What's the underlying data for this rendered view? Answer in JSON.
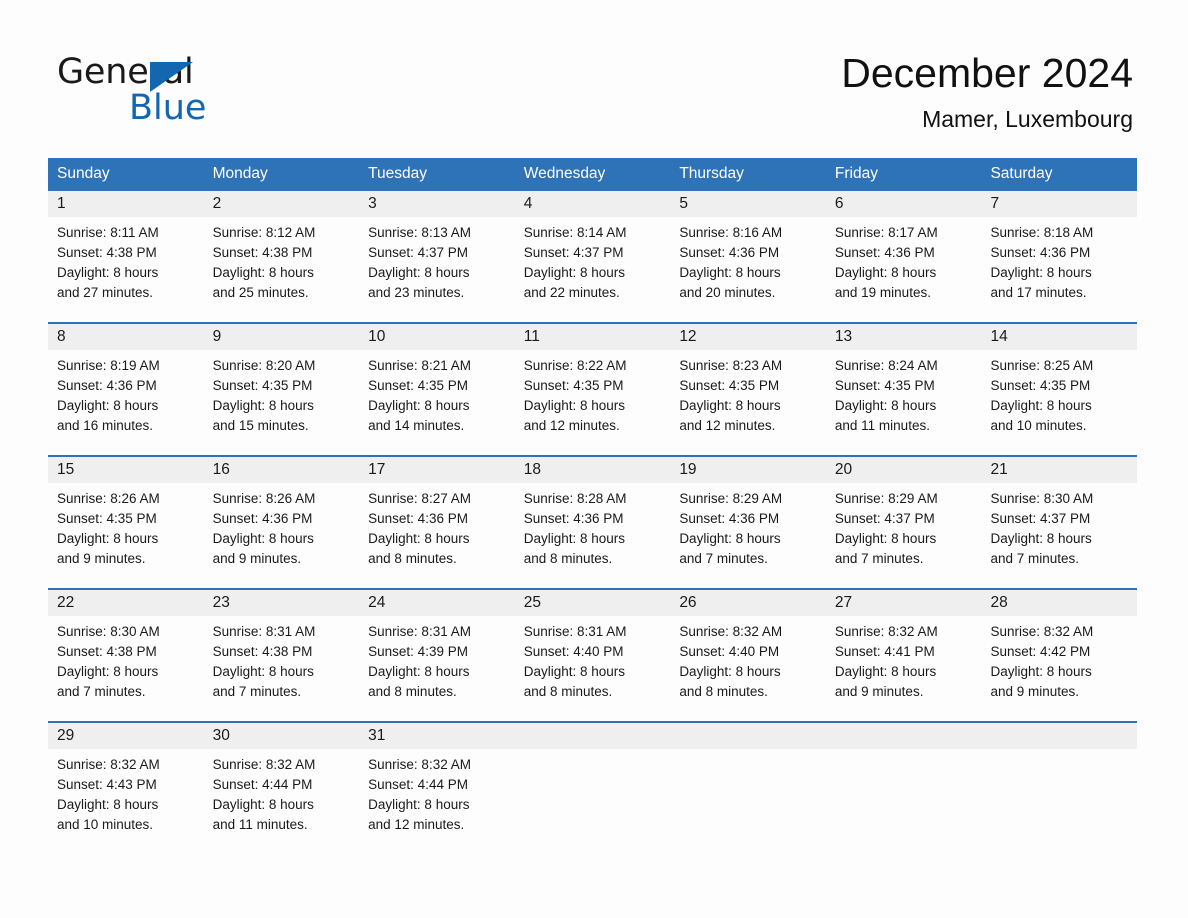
{
  "brand": {
    "name_part1": "General",
    "name_part2": "Blue",
    "triangle_icon": "triangle-icon",
    "accent_color": "#1267b0"
  },
  "header": {
    "month_title": "December 2024",
    "location": "Mamer, Luxembourg"
  },
  "colors": {
    "header_blue": "#2e72b8",
    "day_band_gray": "#efefef",
    "text": "#1a1a1a"
  },
  "weekdays": [
    "Sunday",
    "Monday",
    "Tuesday",
    "Wednesday",
    "Thursday",
    "Friday",
    "Saturday"
  ],
  "weeks": [
    [
      {
        "day": "1",
        "sunrise": "Sunrise: 8:11 AM",
        "sunset": "Sunset: 4:38 PM",
        "daylight_l1": "Daylight: 8 hours",
        "daylight_l2": "and 27 minutes."
      },
      {
        "day": "2",
        "sunrise": "Sunrise: 8:12 AM",
        "sunset": "Sunset: 4:38 PM",
        "daylight_l1": "Daylight: 8 hours",
        "daylight_l2": "and 25 minutes."
      },
      {
        "day": "3",
        "sunrise": "Sunrise: 8:13 AM",
        "sunset": "Sunset: 4:37 PM",
        "daylight_l1": "Daylight: 8 hours",
        "daylight_l2": "and 23 minutes."
      },
      {
        "day": "4",
        "sunrise": "Sunrise: 8:14 AM",
        "sunset": "Sunset: 4:37 PM",
        "daylight_l1": "Daylight: 8 hours",
        "daylight_l2": "and 22 minutes."
      },
      {
        "day": "5",
        "sunrise": "Sunrise: 8:16 AM",
        "sunset": "Sunset: 4:36 PM",
        "daylight_l1": "Daylight: 8 hours",
        "daylight_l2": "and 20 minutes."
      },
      {
        "day": "6",
        "sunrise": "Sunrise: 8:17 AM",
        "sunset": "Sunset: 4:36 PM",
        "daylight_l1": "Daylight: 8 hours",
        "daylight_l2": "and 19 minutes."
      },
      {
        "day": "7",
        "sunrise": "Sunrise: 8:18 AM",
        "sunset": "Sunset: 4:36 PM",
        "daylight_l1": "Daylight: 8 hours",
        "daylight_l2": "and 17 minutes."
      }
    ],
    [
      {
        "day": "8",
        "sunrise": "Sunrise: 8:19 AM",
        "sunset": "Sunset: 4:36 PM",
        "daylight_l1": "Daylight: 8 hours",
        "daylight_l2": "and 16 minutes."
      },
      {
        "day": "9",
        "sunrise": "Sunrise: 8:20 AM",
        "sunset": "Sunset: 4:35 PM",
        "daylight_l1": "Daylight: 8 hours",
        "daylight_l2": "and 15 minutes."
      },
      {
        "day": "10",
        "sunrise": "Sunrise: 8:21 AM",
        "sunset": "Sunset: 4:35 PM",
        "daylight_l1": "Daylight: 8 hours",
        "daylight_l2": "and 14 minutes."
      },
      {
        "day": "11",
        "sunrise": "Sunrise: 8:22 AM",
        "sunset": "Sunset: 4:35 PM",
        "daylight_l1": "Daylight: 8 hours",
        "daylight_l2": "and 12 minutes."
      },
      {
        "day": "12",
        "sunrise": "Sunrise: 8:23 AM",
        "sunset": "Sunset: 4:35 PM",
        "daylight_l1": "Daylight: 8 hours",
        "daylight_l2": "and 12 minutes."
      },
      {
        "day": "13",
        "sunrise": "Sunrise: 8:24 AM",
        "sunset": "Sunset: 4:35 PM",
        "daylight_l1": "Daylight: 8 hours",
        "daylight_l2": "and 11 minutes."
      },
      {
        "day": "14",
        "sunrise": "Sunrise: 8:25 AM",
        "sunset": "Sunset: 4:35 PM",
        "daylight_l1": "Daylight: 8 hours",
        "daylight_l2": "and 10 minutes."
      }
    ],
    [
      {
        "day": "15",
        "sunrise": "Sunrise: 8:26 AM",
        "sunset": "Sunset: 4:35 PM",
        "daylight_l1": "Daylight: 8 hours",
        "daylight_l2": "and 9 minutes."
      },
      {
        "day": "16",
        "sunrise": "Sunrise: 8:26 AM",
        "sunset": "Sunset: 4:36 PM",
        "daylight_l1": "Daylight: 8 hours",
        "daylight_l2": "and 9 minutes."
      },
      {
        "day": "17",
        "sunrise": "Sunrise: 8:27 AM",
        "sunset": "Sunset: 4:36 PM",
        "daylight_l1": "Daylight: 8 hours",
        "daylight_l2": "and 8 minutes."
      },
      {
        "day": "18",
        "sunrise": "Sunrise: 8:28 AM",
        "sunset": "Sunset: 4:36 PM",
        "daylight_l1": "Daylight: 8 hours",
        "daylight_l2": "and 8 minutes."
      },
      {
        "day": "19",
        "sunrise": "Sunrise: 8:29 AM",
        "sunset": "Sunset: 4:36 PM",
        "daylight_l1": "Daylight: 8 hours",
        "daylight_l2": "and 7 minutes."
      },
      {
        "day": "20",
        "sunrise": "Sunrise: 8:29 AM",
        "sunset": "Sunset: 4:37 PM",
        "daylight_l1": "Daylight: 8 hours",
        "daylight_l2": "and 7 minutes."
      },
      {
        "day": "21",
        "sunrise": "Sunrise: 8:30 AM",
        "sunset": "Sunset: 4:37 PM",
        "daylight_l1": "Daylight: 8 hours",
        "daylight_l2": "and 7 minutes."
      }
    ],
    [
      {
        "day": "22",
        "sunrise": "Sunrise: 8:30 AM",
        "sunset": "Sunset: 4:38 PM",
        "daylight_l1": "Daylight: 8 hours",
        "daylight_l2": "and 7 minutes."
      },
      {
        "day": "23",
        "sunrise": "Sunrise: 8:31 AM",
        "sunset": "Sunset: 4:38 PM",
        "daylight_l1": "Daylight: 8 hours",
        "daylight_l2": "and 7 minutes."
      },
      {
        "day": "24",
        "sunrise": "Sunrise: 8:31 AM",
        "sunset": "Sunset: 4:39 PM",
        "daylight_l1": "Daylight: 8 hours",
        "daylight_l2": "and 8 minutes."
      },
      {
        "day": "25",
        "sunrise": "Sunrise: 8:31 AM",
        "sunset": "Sunset: 4:40 PM",
        "daylight_l1": "Daylight: 8 hours",
        "daylight_l2": "and 8 minutes."
      },
      {
        "day": "26",
        "sunrise": "Sunrise: 8:32 AM",
        "sunset": "Sunset: 4:40 PM",
        "daylight_l1": "Daylight: 8 hours",
        "daylight_l2": "and 8 minutes."
      },
      {
        "day": "27",
        "sunrise": "Sunrise: 8:32 AM",
        "sunset": "Sunset: 4:41 PM",
        "daylight_l1": "Daylight: 8 hours",
        "daylight_l2": "and 9 minutes."
      },
      {
        "day": "28",
        "sunrise": "Sunrise: 8:32 AM",
        "sunset": "Sunset: 4:42 PM",
        "daylight_l1": "Daylight: 8 hours",
        "daylight_l2": "and 9 minutes."
      }
    ],
    [
      {
        "day": "29",
        "sunrise": "Sunrise: 8:32 AM",
        "sunset": "Sunset: 4:43 PM",
        "daylight_l1": "Daylight: 8 hours",
        "daylight_l2": "and 10 minutes."
      },
      {
        "day": "30",
        "sunrise": "Sunrise: 8:32 AM",
        "sunset": "Sunset: 4:44 PM",
        "daylight_l1": "Daylight: 8 hours",
        "daylight_l2": "and 11 minutes."
      },
      {
        "day": "31",
        "sunrise": "Sunrise: 8:32 AM",
        "sunset": "Sunset: 4:44 PM",
        "daylight_l1": "Daylight: 8 hours",
        "daylight_l2": "and 12 minutes."
      },
      {
        "day": "",
        "sunrise": "",
        "sunset": "",
        "daylight_l1": "",
        "daylight_l2": ""
      },
      {
        "day": "",
        "sunrise": "",
        "sunset": "",
        "daylight_l1": "",
        "daylight_l2": ""
      },
      {
        "day": "",
        "sunrise": "",
        "sunset": "",
        "daylight_l1": "",
        "daylight_l2": ""
      },
      {
        "day": "",
        "sunrise": "",
        "sunset": "",
        "daylight_l1": "",
        "daylight_l2": ""
      }
    ]
  ]
}
